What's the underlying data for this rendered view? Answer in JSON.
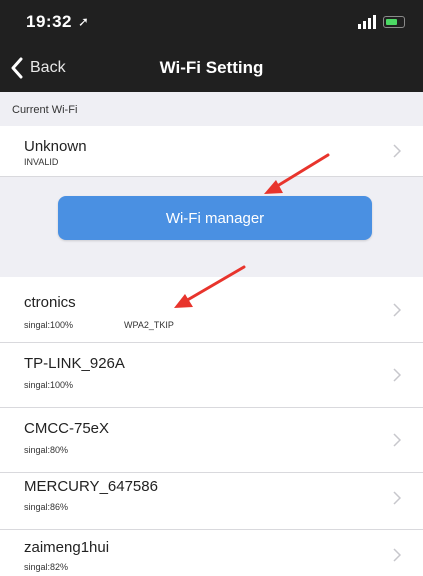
{
  "status_bar": {
    "time": "19:32",
    "location_glyph": "➚"
  },
  "nav": {
    "back_label": "Back",
    "title": "Wi-Fi Setting"
  },
  "current_section": {
    "header": "Current Wi-Fi"
  },
  "current_network": {
    "name": "Unknown",
    "status": "INVALID"
  },
  "manager_button": {
    "label": "Wi-Fi manager"
  },
  "networks": [
    {
      "name": "ctronics",
      "signal": "singal:100%",
      "security": "WPA2_TKIP"
    },
    {
      "name": "TP-LINK_926A",
      "signal": "singal:100%",
      "security": ""
    },
    {
      "name": "CMCC-75eX",
      "signal": "singal:80%",
      "security": ""
    },
    {
      "name": "MERCURY_647586",
      "signal": "singal:86%",
      "security": ""
    },
    {
      "name": "zaimeng1hui",
      "signal": "singal:82%",
      "security": ""
    }
  ],
  "colors": {
    "accent": "#4a90e2",
    "annotation": "#e8342c",
    "bar": "#202020"
  },
  "icons": [
    "location-arrow-icon",
    "signal-bars-icon",
    "battery-icon",
    "back-chevron-icon",
    "chevron-right-icon",
    "annotation-arrow-icon"
  ]
}
